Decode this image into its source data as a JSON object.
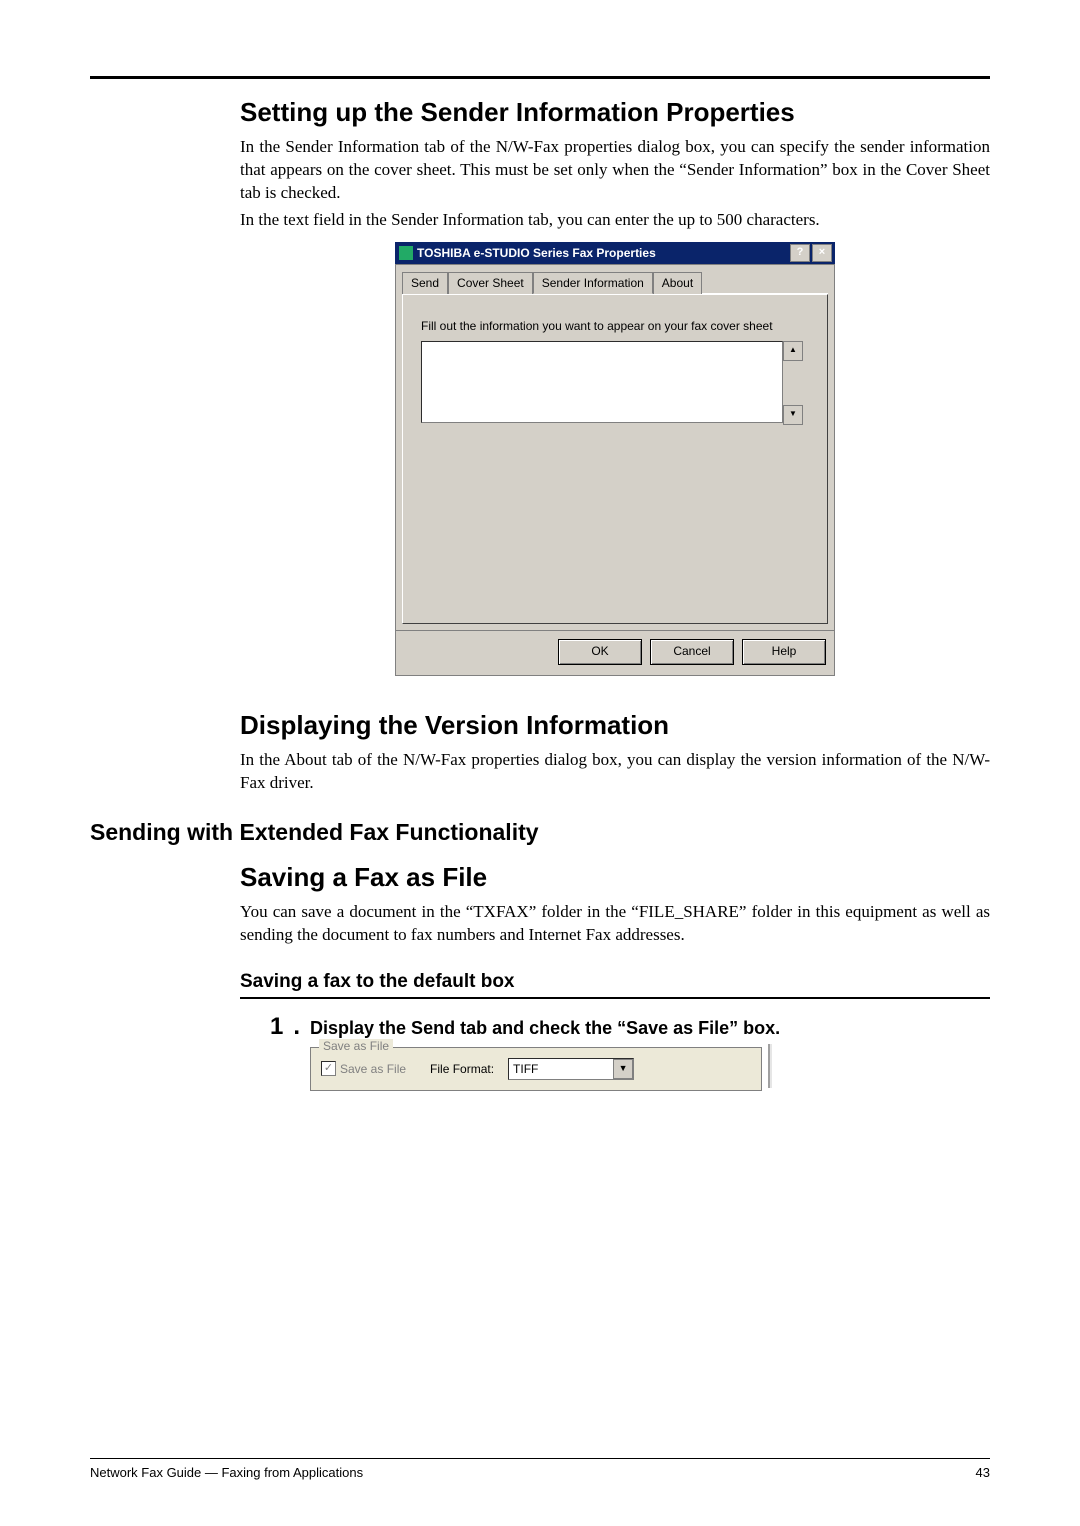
{
  "heading_sender": "Setting up the Sender Information Properties",
  "para_sender_1": "In the Sender Information tab of the N/W-Fax properties dialog box, you can specify the sender information that appears on the cover sheet.  This must be set only when the “Sender Information” box in the Cover Sheet tab is checked.",
  "para_sender_2": "In the text field in the Sender Information tab, you can enter the up to 500 characters.",
  "dialog": {
    "title": "TOSHIBA e-STUDIO Series Fax Properties",
    "help_btn": "?",
    "close_btn": "×",
    "tabs": {
      "send": "Send",
      "cover": "Cover Sheet",
      "sender": "Sender Information",
      "about": "About"
    },
    "helper": "Fill out the information you want to appear on your fax cover sheet",
    "scroll_up": "▲",
    "scroll_down": "▼",
    "ok": "OK",
    "cancel": "Cancel",
    "help": "Help"
  },
  "heading_version": "Displaying the Version Information",
  "para_version": "In the About tab of the N/W-Fax properties dialog box, you can display the version information of the N/W-Fax driver.",
  "section_extended": "Sending with Extended Fax Functionality",
  "heading_saveasfile": "Saving a Fax as File",
  "para_saveasfile": "You can save a document in the “TXFAX” folder in the “FILE_SHARE” folder in this equipment as well as sending the document to fax numbers and Internet Fax addresses.",
  "subsec_defaultbox": "Saving a fax to the default box",
  "step": {
    "num": "1",
    "dot": ".",
    "text": "Display the Send tab and check the “Save as File” box."
  },
  "groupbox": {
    "legend": "Save as File",
    "checkbox_label": "Save as File",
    "checkmark": "✓",
    "fileformat_label": "File Format:",
    "fileformat_value": "TIFF",
    "chevron": "▼"
  },
  "footer": {
    "left": "Network Fax Guide — Faxing from Applications",
    "right": "43"
  }
}
